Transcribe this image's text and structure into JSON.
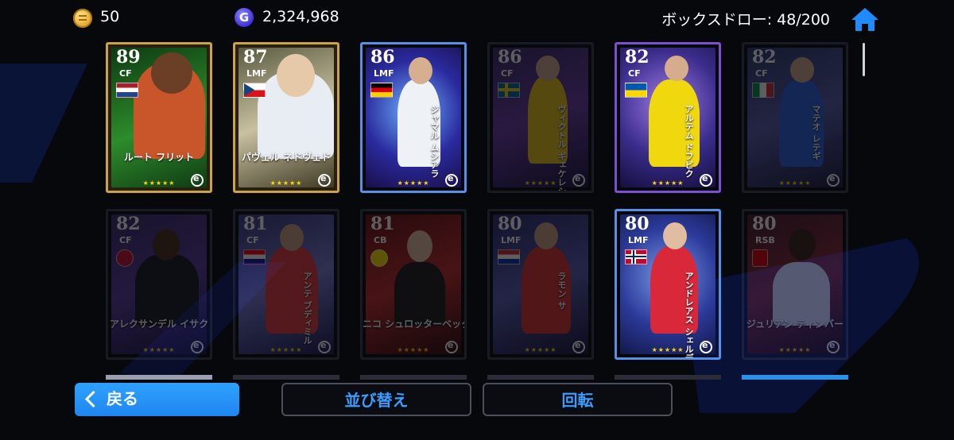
{
  "currency": {
    "coins": "50",
    "gp": "2,324,968",
    "gp_symbol": "G"
  },
  "box_draw": {
    "label": "ボックスドロー: 48/200"
  },
  "buttons": {
    "back": "戻る",
    "sort": "並び替え",
    "rotate": "回転"
  },
  "cards": [
    {
      "rating": "89",
      "position": "CF",
      "name": "ルート フリット",
      "stars": "★★★★★",
      "flag": "netherlands",
      "dimmed": false,
      "frame": "gold"
    },
    {
      "rating": "87",
      "position": "LMF",
      "name": "パヴェル ネドヴェド",
      "stars": "★★★★★",
      "flag": "czech",
      "dimmed": false,
      "frame": "gold"
    },
    {
      "rating": "86",
      "position": "LMF",
      "name": "ジャマル ムシアラ",
      "stars": "★★★★★",
      "flag": "germany",
      "dimmed": false,
      "frame": "blue"
    },
    {
      "rating": "86",
      "position": "CF",
      "name": "ヴィクトル ギェケレシュ",
      "stars": "★★★★★",
      "flag": "sweden",
      "dimmed": true,
      "frame": "dim"
    },
    {
      "rating": "82",
      "position": "CF",
      "name": "アルテム ドフビク",
      "stars": "★★★★★",
      "flag": "ukraine",
      "dimmed": false,
      "frame": "purple"
    },
    {
      "rating": "82",
      "position": "CF",
      "name": "マテオ レテギ",
      "stars": "★★★★★",
      "flag": "italy",
      "dimmed": true,
      "frame": "dim"
    },
    {
      "rating": "82",
      "position": "CF",
      "name": "アレクサンデル イサク",
      "stars": "★★★★★",
      "flag": "club",
      "dimmed": true,
      "frame": "dim"
    },
    {
      "rating": "81",
      "position": "CF",
      "name": "アンテ ブディミル",
      "stars": "★★★★★",
      "flag": "croatia",
      "dimmed": true,
      "frame": "dim"
    },
    {
      "rating": "81",
      "position": "CB",
      "name": "ニコ シュロッターベック",
      "stars": "★★★★★",
      "flag": "bvb",
      "dimmed": true,
      "frame": "dim"
    },
    {
      "rating": "80",
      "position": "LMF",
      "name": "ラモン サ",
      "stars": "★★★★★",
      "flag": "paraguay",
      "dimmed": true,
      "frame": "dim"
    },
    {
      "rating": "80",
      "position": "LMF",
      "name": "アンドレアス シェルデルップ",
      "stars": "★★★★★",
      "flag": "norway",
      "dimmed": false,
      "frame": "blue"
    },
    {
      "rating": "80",
      "position": "RSB",
      "name": "ジュリアン ティンバー",
      "stars": "★★★★★",
      "flag": "club2",
      "dimmed": true,
      "frame": "dim"
    }
  ]
}
